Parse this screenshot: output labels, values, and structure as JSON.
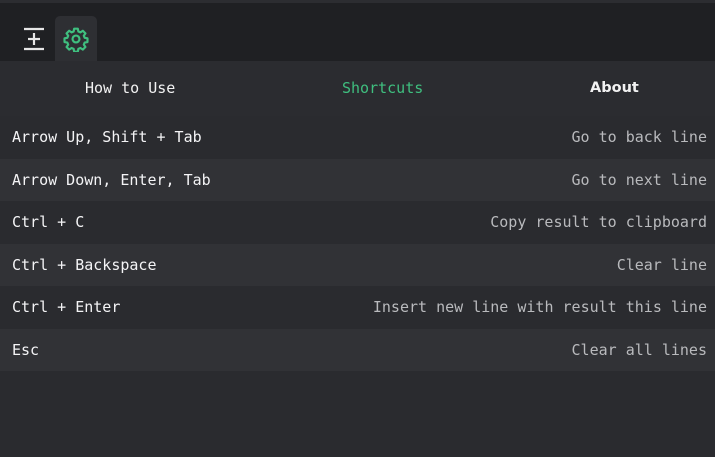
{
  "toolbar": {
    "buttons": [
      {
        "icon": "expand-lines-icon",
        "active": false
      },
      {
        "icon": "gear-icon",
        "active": true
      }
    ]
  },
  "tabs": [
    {
      "label": "How to Use",
      "active": false
    },
    {
      "label": "Shortcuts",
      "active": true
    },
    {
      "label": "About",
      "active": false
    }
  ],
  "shortcuts": [
    {
      "keys": "Arrow Up, Shift + Tab",
      "action": "Go to back line"
    },
    {
      "keys": "Arrow Down, Enter, Tab",
      "action": "Go to next line"
    },
    {
      "keys": "Ctrl + C",
      "action": "Copy result to clipboard"
    },
    {
      "keys": "Ctrl + Backspace",
      "action": "Clear line"
    },
    {
      "keys": "Ctrl + Enter",
      "action": "Insert new line with result this line"
    },
    {
      "keys": "Esc",
      "action": "Clear all lines"
    }
  ],
  "colors": {
    "accent": "#3fbf7f",
    "background": "#2a2b2f",
    "topbar": "#1f2023"
  }
}
